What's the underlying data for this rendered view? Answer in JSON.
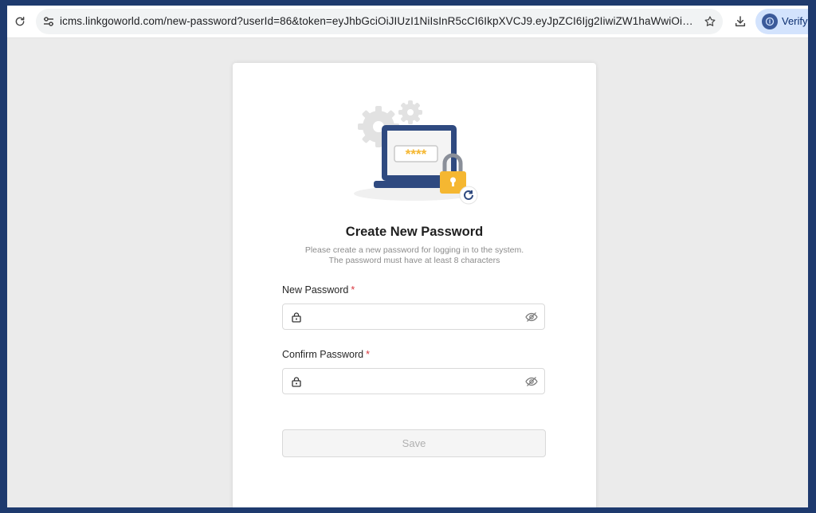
{
  "browser": {
    "url": "icms.linkgoworld.com/new-password?userId=86&token=eyJhbGciOiJIUzI1NiIsInR5cCI6IkpXVCJ9.eyJpZCI6Ijg2IiwiZW1haWwiOiJzZWxlbm",
    "extension_label": "Verify i",
    "icons": [
      "reload-icon",
      "site-info-icon",
      "star-icon",
      "download-icon",
      "extension-badge-icon"
    ]
  },
  "form": {
    "title": "Create New Password",
    "subtitle_line1": "Please create a new password for logging in to the system.",
    "subtitle_line2": "The password must have at least 8 characters",
    "new_password_label": "New Password",
    "confirm_password_label": "Confirm Password",
    "required_mark": "*",
    "new_password_value": "",
    "confirm_password_value": "",
    "illustration_password_mask": "****",
    "save_label": "Save",
    "save_enabled": false,
    "colors": {
      "required": "#d9363e",
      "laptop": "#2f4a80",
      "lock": "#f5b731",
      "disabled_button_bg": "#f5f5f5"
    }
  }
}
